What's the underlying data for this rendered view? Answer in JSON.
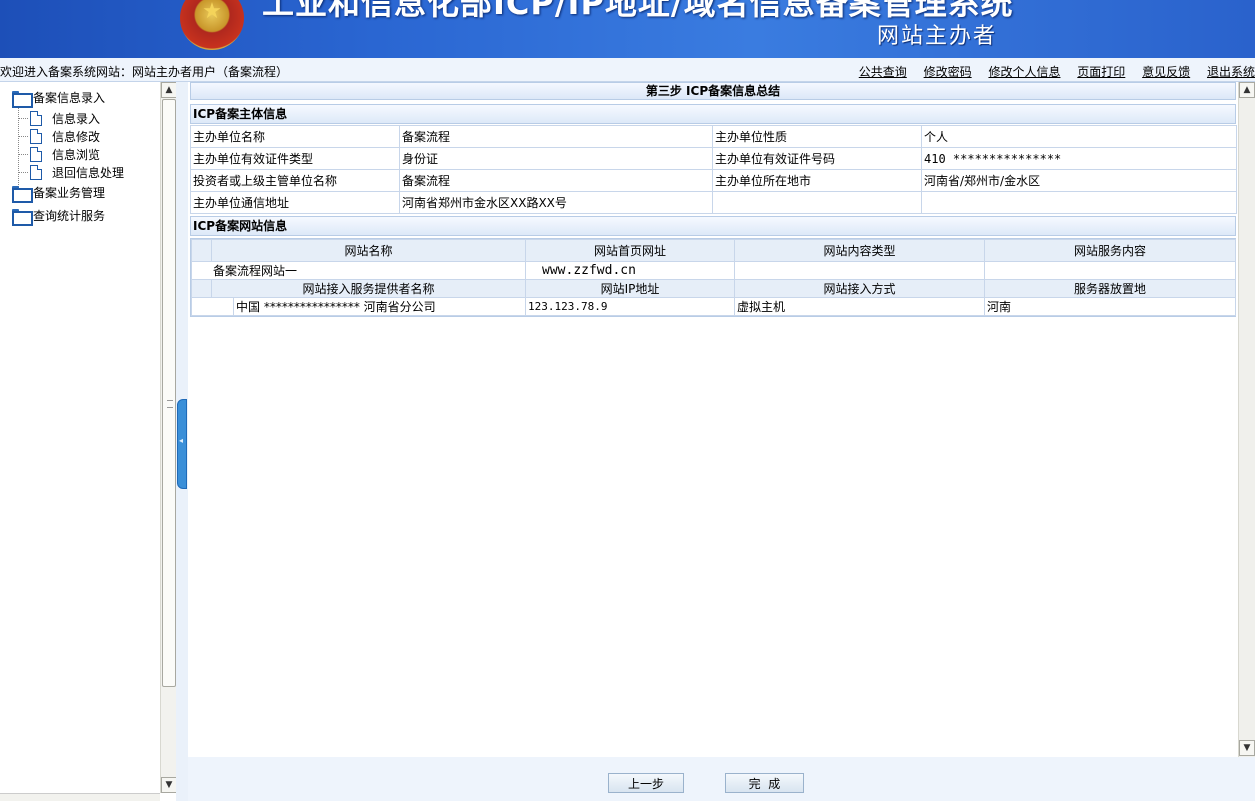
{
  "banner": {
    "title": "工业和信息化部ICP/IP地址/域名信息备案管理系统",
    "subtitle": "网站主办者"
  },
  "topbar": {
    "welcome": "欢迎进入备案系统网站：网站主办者用户（备案流程）",
    "links": [
      "公共查询",
      "修改密码",
      "修改个人信息",
      "页面打印",
      "意见反馈",
      "退出系统"
    ]
  },
  "tree": {
    "root1": "备案信息录入",
    "children": [
      "信息录入",
      "信息修改",
      "信息浏览",
      "退回信息处理"
    ],
    "root2": "备案业务管理",
    "root3": "查询统计服务"
  },
  "main": {
    "step_title": "第三步  ICP备案信息总结",
    "section1": "ICP备案主体信息",
    "info_rows": [
      [
        "主办单位名称",
        "备案流程",
        "主办单位性质",
        "个人"
      ],
      [
        "主办单位有效证件类型",
        "身份证",
        "主办单位有效证件号码",
        "410 ***************"
      ],
      [
        "投资者或上级主管单位名称",
        "备案流程",
        "主办单位所在地市",
        "河南省/郑州市/金水区"
      ],
      [
        "主办单位通信地址",
        "河南省郑州市金水区XX路XX号",
        "",
        ""
      ]
    ],
    "section2": "ICP备案网站信息",
    "site_headers": [
      "网站名称",
      "网站首页网址",
      "网站内容类型",
      "网站服务内容"
    ],
    "site_row": [
      "备案流程网站一",
      "www.zzfwd.cn",
      "",
      ""
    ],
    "access_headers": [
      "网站接入服务提供者名称",
      "网站IP地址",
      "网站接入方式",
      "服务器放置地"
    ],
    "access_row": [
      "中国 **************** 河南省分公司",
      "123.123.78.9",
      "虚拟主机",
      "河南"
    ]
  },
  "buttons": {
    "prev": "上一步",
    "finish": "完  成"
  }
}
